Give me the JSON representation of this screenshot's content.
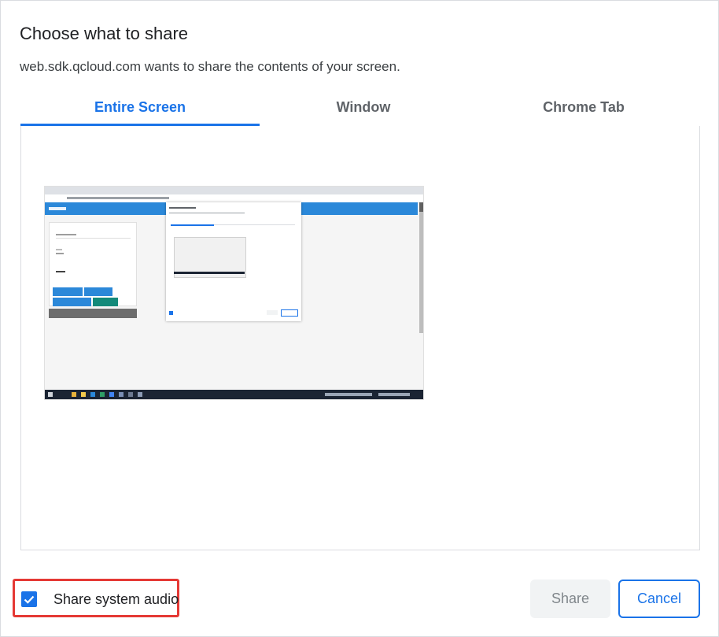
{
  "dialog": {
    "title": "Choose what to share",
    "subtitle": "web.sdk.qcloud.com wants to share the contents of your screen."
  },
  "tabs": [
    {
      "label": "Entire Screen",
      "active": true
    },
    {
      "label": "Window",
      "active": false
    },
    {
      "label": "Chrome Tab",
      "active": false
    }
  ],
  "screen_thumbnail": {
    "icon": "screen-preview",
    "selected": true
  },
  "audio": {
    "label": "Share system audio",
    "checked": true
  },
  "buttons": {
    "share_label": "Share",
    "share_enabled": false,
    "cancel_label": "Cancel"
  },
  "colors": {
    "accent": "#1a73e8",
    "highlight_box": "#e53935",
    "disabled_bg": "#f1f3f4"
  }
}
